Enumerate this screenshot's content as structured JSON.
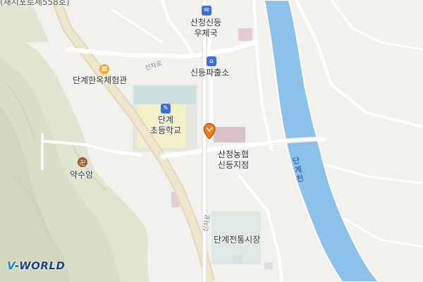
{
  "map": {
    "top_cut_label": "(새시포로세558호)",
    "pois": {
      "post_office": "산청신등\n우체국",
      "police": "신등파출소",
      "hanok": "단계한옥체험관",
      "school": "단계\n초등학교",
      "temple": "약수암",
      "bank": "산청농협\n신등지점",
      "market": "단계전통시장"
    },
    "roads": {
      "road1": "신차로",
      "road2": "신차로"
    },
    "river": "단계천",
    "logo": {
      "prefix": "V",
      "rest": "-WORLD"
    },
    "colors": {
      "river": "#7fb8e8",
      "post_icon": "#3f6fd6",
      "police_icon": "#3f6fd6",
      "hanok_icon": "#f0a623",
      "school_icon": "#3f6fd6",
      "temple_icon": "#9b5a2a",
      "marker": "#f07a1a"
    }
  }
}
